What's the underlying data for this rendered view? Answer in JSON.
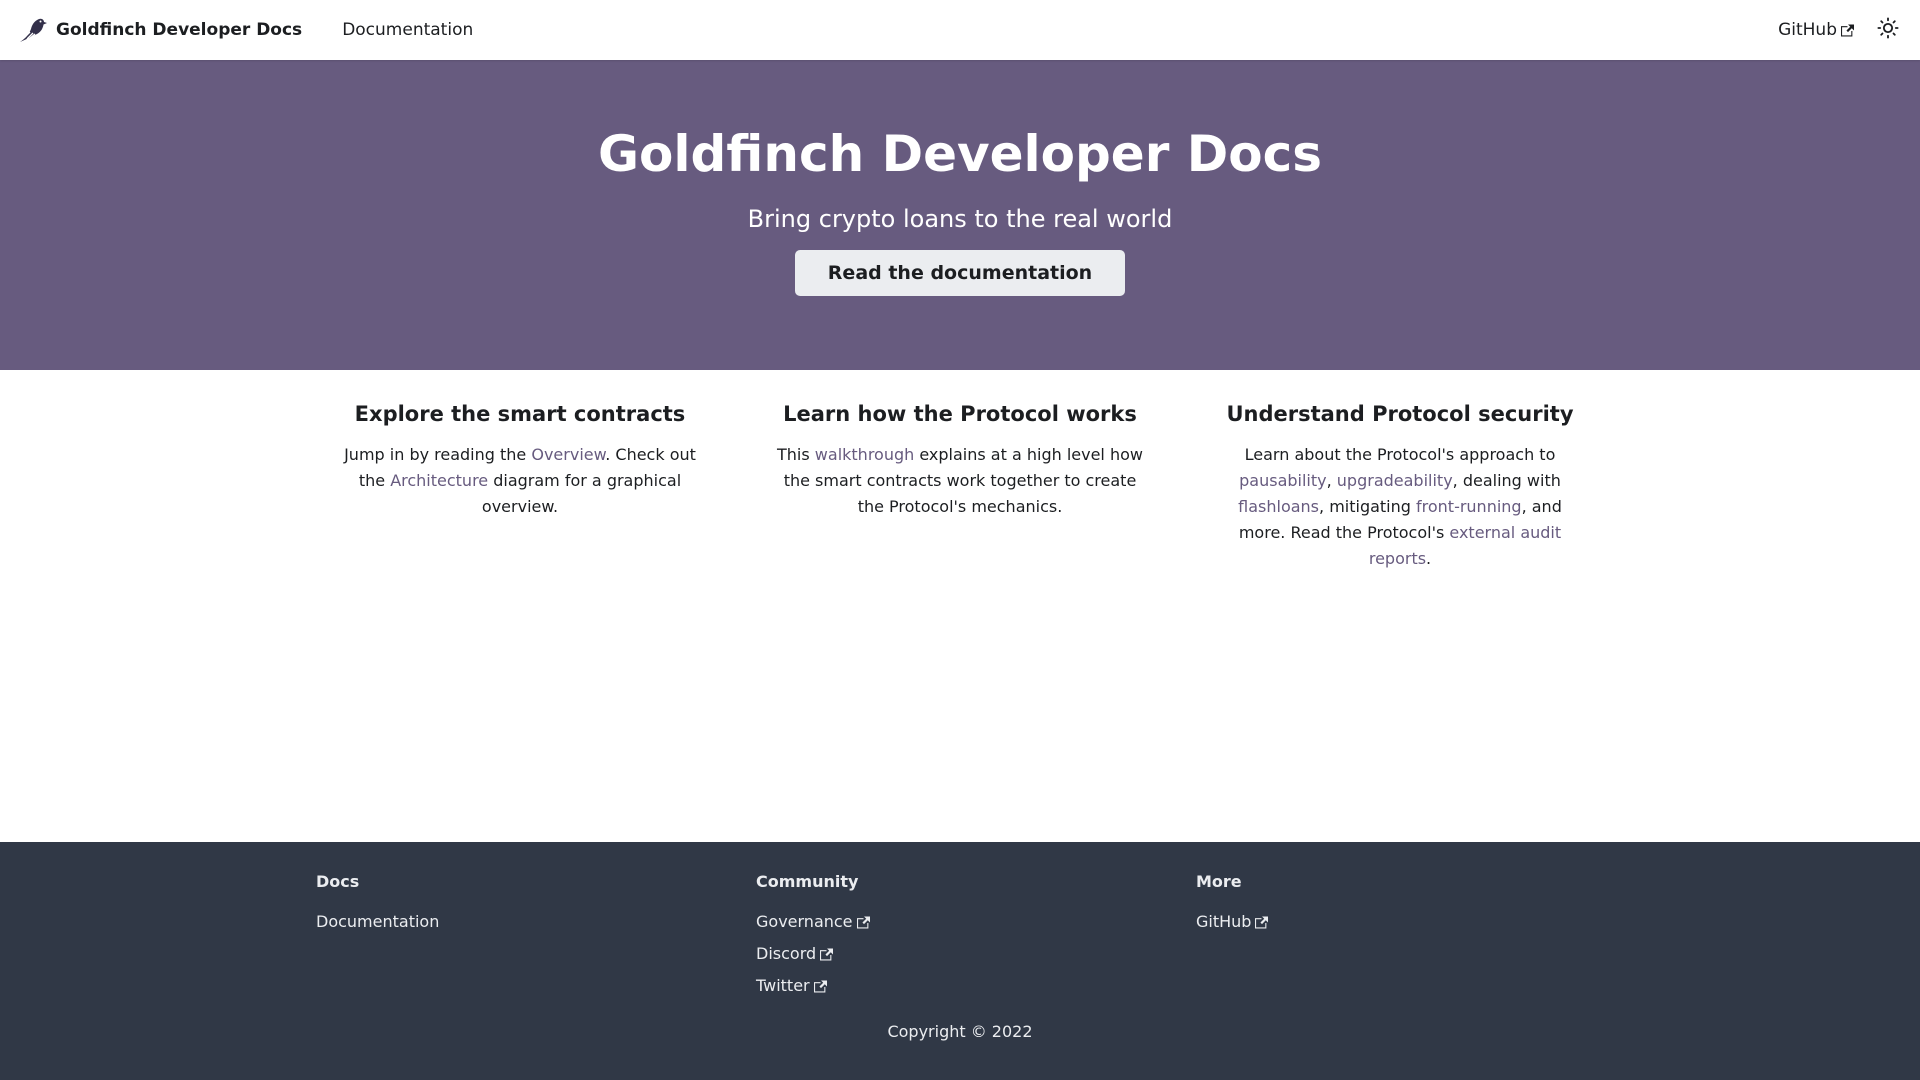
{
  "navbar": {
    "brand_title": "Goldfinch Developer Docs",
    "brand_icon": "goldfinch-bird-logo",
    "documentation_label": "Documentation",
    "github_label": "GitHub",
    "theme_toggle_icon": "sun-icon"
  },
  "hero": {
    "title": "Goldfinch Developer Docs",
    "subtitle": "Bring crypto loans to the real world",
    "button_label": "Read the documentation",
    "background_color": "#675b7f"
  },
  "features": [
    {
      "title": "Explore the smart contracts",
      "t1": "Jump in by reading the ",
      "l1": "Overview",
      "t2": ". Check out the ",
      "l2": "Architecture",
      "t3": " diagram for a graphical overview."
    },
    {
      "title": "Learn how the Protocol works",
      "t1": "This ",
      "l1": "walkthrough",
      "t2": " explains at a high level how the smart contracts work together to create the Protocol's mechanics."
    },
    {
      "title": "Understand Protocol security",
      "t1": "Learn about the Protocol's approach to ",
      "l1": "pausability",
      "t2": ", ",
      "l2": "upgradeability",
      "t3": ", dealing with ",
      "l3": "flashloans",
      "t4": ", mitigating ",
      "l4": "front-running",
      "t5": ", and more. Read the Protocol's ",
      "l5": "external audit reports",
      "t6": "."
    }
  ],
  "footer": {
    "columns": [
      {
        "title": "Docs",
        "links": [
          "Documentation"
        ]
      },
      {
        "title": "Community",
        "links": [
          "Governance",
          "Discord",
          "Twitter"
        ]
      },
      {
        "title": "More",
        "links": [
          "GitHub"
        ]
      }
    ],
    "copyright": "Copyright © 2022",
    "background_color": "#303846"
  },
  "colors": {
    "accent": "#675b7f",
    "footer": "#303846",
    "button_bg": "#ebedf0"
  }
}
